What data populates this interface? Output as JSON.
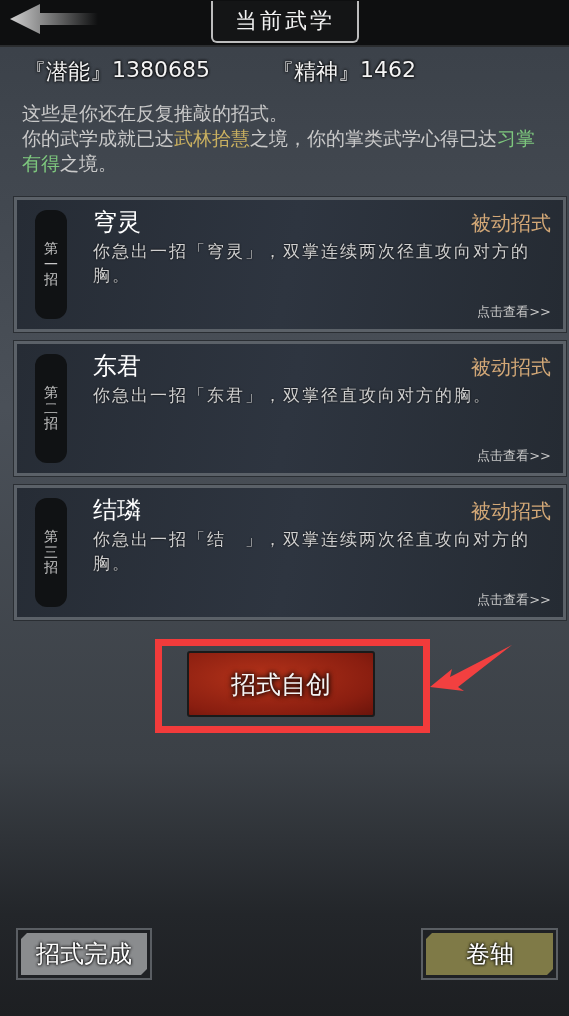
{
  "header": {
    "title": "当前武学"
  },
  "stats": [
    {
      "label": "『潜能』",
      "value": "1380685"
    },
    {
      "label": "『精神』",
      "value": "1462"
    }
  ],
  "description": [
    {
      "kind": "plain",
      "text": "这些是你还在反复推敲的招式。"
    },
    {
      "kind": "break"
    },
    {
      "kind": "plain",
      "text": "你的武学成就已达"
    },
    {
      "kind": "realm",
      "text": "武林拾慧"
    },
    {
      "kind": "plain",
      "text": "之境，你的掌类武学心得已达"
    },
    {
      "kind": "mastery",
      "text": "习掌有得"
    },
    {
      "kind": "plain",
      "text": "之境。"
    }
  ],
  "moves": [
    {
      "order": "第一招",
      "name": "穹灵",
      "type": "被动招式",
      "desc": "你急出一招「穹灵」，双掌连续两次径直攻向对方的胸。",
      "link": "点击查看>>"
    },
    {
      "order": "第二招",
      "name": "东君",
      "type": "被动招式",
      "desc": "你急出一招「东君」，双掌径直攻向对方的胸。",
      "link": "点击查看>>"
    },
    {
      "order": "第三招",
      "name": "结璘",
      "type": "被动招式",
      "desc": "你急出一招「结　」，双掌连续两次径直攻向对方的胸。",
      "link": "点击查看>>"
    }
  ],
  "create_button": {
    "label": "招式自创",
    "highlighted": true
  },
  "bottom_buttons": [
    {
      "kind": "grey",
      "label": "招式完成"
    },
    {
      "kind": "olive",
      "label": "卷轴"
    }
  ]
}
